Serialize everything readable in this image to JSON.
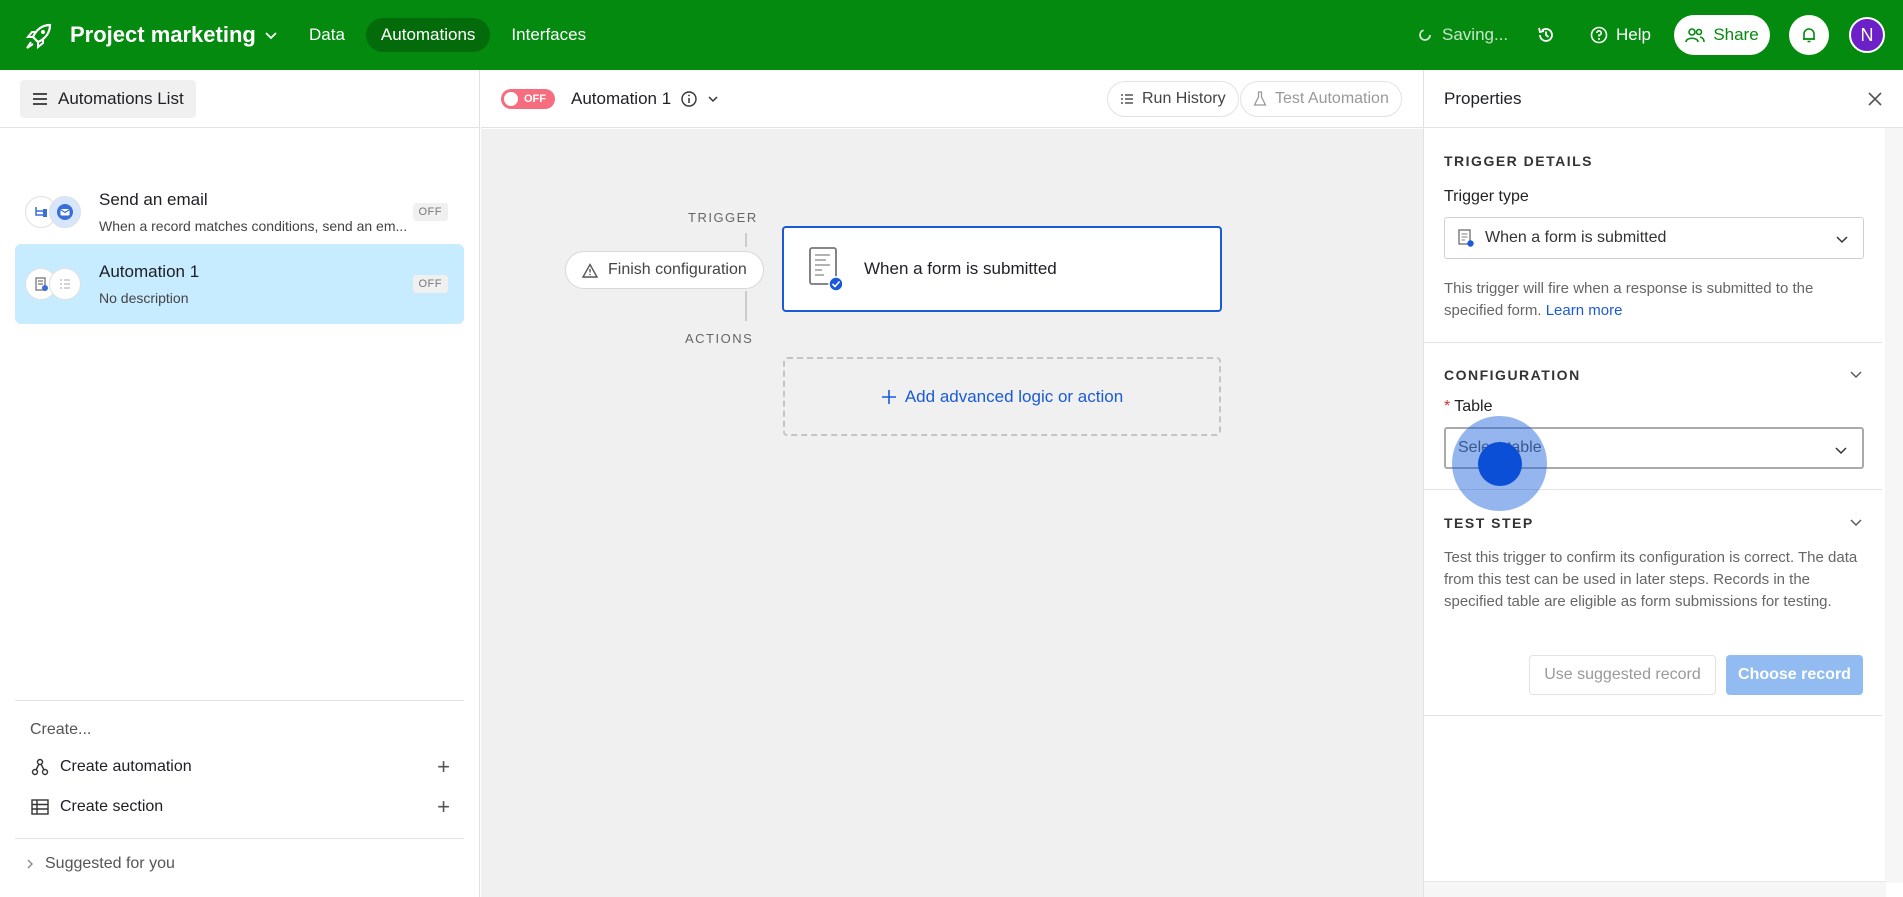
{
  "header": {
    "base_name": "Project marketing",
    "nav": [
      "Data",
      "Automations",
      "Interfaces"
    ],
    "active_nav": "Automations",
    "saving_text": "Saving...",
    "help_label": "Help",
    "share_label": "Share",
    "avatar_initial": "N"
  },
  "sidebar": {
    "list_button": "Automations List",
    "automations": [
      {
        "name": "Send an email",
        "description": "When a record matches conditions, send an em...",
        "status": "OFF"
      },
      {
        "name": "Automation 1",
        "description": "No description",
        "status": "OFF"
      }
    ],
    "create_label": "Create...",
    "create_automation": "Create automation",
    "create_section": "Create section",
    "suggested": "Suggested for you"
  },
  "canvas": {
    "toggle_label": "OFF",
    "automation_title": "Automation 1",
    "run_history": "Run History",
    "test_automation": "Test Automation",
    "trigger_label": "TRIGGER",
    "actions_label": "ACTIONS",
    "finish_config": "Finish configuration",
    "trigger_name": "When a form is submitted",
    "add_action": "Add advanced logic or action"
  },
  "properties": {
    "title": "Properties",
    "trigger_details": "TRIGGER DETAILS",
    "trigger_type_label": "Trigger type",
    "trigger_type_value": "When a form is submitted",
    "trigger_help": "This trigger will fire when a response is submitted to the specified form.",
    "learn_more": "Learn more",
    "configuration": "CONFIGURATION",
    "required_mark": "*",
    "table_label": "Table",
    "table_placeholder": "Select table",
    "test_step": "TEST STEP",
    "test_help": "Test this trigger to confirm its configuration is correct. The data from this test can be used in later steps. Records in the specified table are eligible as form submissions for testing.",
    "use_suggested": "Use suggested record",
    "choose_record": "Choose record"
  },
  "colors": {
    "topbar": "#048a0e",
    "accent": "#1a5ad8",
    "selected_item": "#c7ecff",
    "toggle_off": "#f56d7f"
  }
}
